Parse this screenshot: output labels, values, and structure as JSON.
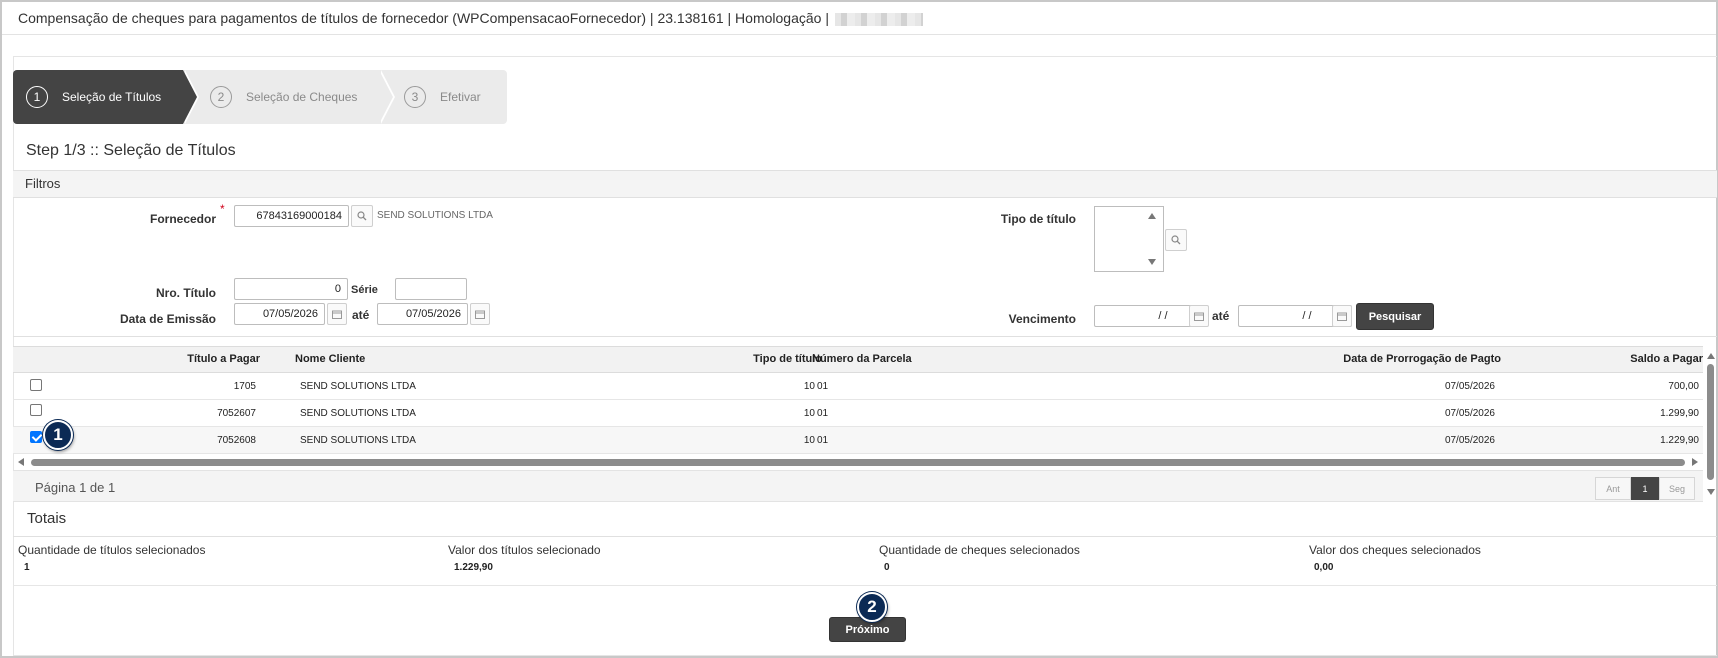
{
  "window": {
    "title": "Compensação de cheques para pagamentos de títulos de fornecedor (WPCompensacaoFornecedor) | 23.138161 | Homologação |"
  },
  "wizard": {
    "steps": [
      {
        "number": "1",
        "label": "Seleção de Títulos"
      },
      {
        "number": "2",
        "label": "Seleção de Cheques"
      },
      {
        "number": "3",
        "label": "Efetivar"
      }
    ]
  },
  "step_title": "Step 1/3 :: Seleção de Títulos",
  "filters": {
    "header": "Filtros",
    "fornecedor_label": "Fornecedor",
    "required_mark": "*",
    "fornecedor_value": "67843169000184",
    "fornecedor_name": "SEND SOLUTIONS LTDA",
    "tipo_titulo_label": "Tipo de título",
    "nro_titulo_label": "Nro. Título",
    "nro_titulo_value": "0",
    "serie_label": "Série",
    "serie_value": "",
    "data_emissao_label": "Data de Emissão",
    "data_emissao_from": "07/05/2026",
    "ate_label": "até",
    "data_emissao_to": "07/05/2026",
    "vencimento_label": "Vencimento",
    "vencimento_from": "/ /",
    "vencimento_to": "/ /",
    "search_button": "Pesquisar"
  },
  "grid": {
    "columns": [
      "Título a Pagar",
      "Nome Cliente",
      "Tipo de título",
      "Número da Parcela",
      "Data de Prorrogação de Pagto",
      "Saldo a Pagar"
    ],
    "rows": [
      {
        "checked": false,
        "titulo": "1705",
        "cliente": "SEND SOLUTIONS LTDA",
        "tipo": "10",
        "parcela": "01",
        "data": "07/05/2026",
        "saldo": "700,00"
      },
      {
        "checked": false,
        "titulo": "7052607",
        "cliente": "SEND SOLUTIONS LTDA",
        "tipo": "10",
        "parcela": "01",
        "data": "07/05/2026",
        "saldo": "1.299,90"
      },
      {
        "checked": true,
        "titulo": "7052608",
        "cliente": "SEND SOLUTIONS LTDA",
        "tipo": "10",
        "parcela": "01",
        "data": "07/05/2026",
        "saldo": "1.229,90"
      }
    ],
    "page_info": "Página 1 de 1",
    "pager": {
      "prev": "Ant",
      "current": "1",
      "next": "Seg"
    }
  },
  "annotations": {
    "badge1": "1",
    "badge2": "2"
  },
  "totais": {
    "title": "Totais",
    "items": [
      {
        "label": "Quantidade de títulos selecionados",
        "value": "1"
      },
      {
        "label": "Valor dos títulos selecionado",
        "value": "1.229,90"
      },
      {
        "label": "Quantidade de cheques selecionados",
        "value": "0"
      },
      {
        "label": "Valor dos cheques selecionados",
        "value": "0,00"
      }
    ]
  },
  "actions": {
    "next_button": "Próximo"
  },
  "colors": {
    "dark": "#444444",
    "badge": "#0b2a55",
    "required": "#d0021b",
    "checkbox": "#0075ff"
  },
  "icons": {
    "lookup": "search-icon",
    "date": "calendar-icon"
  }
}
